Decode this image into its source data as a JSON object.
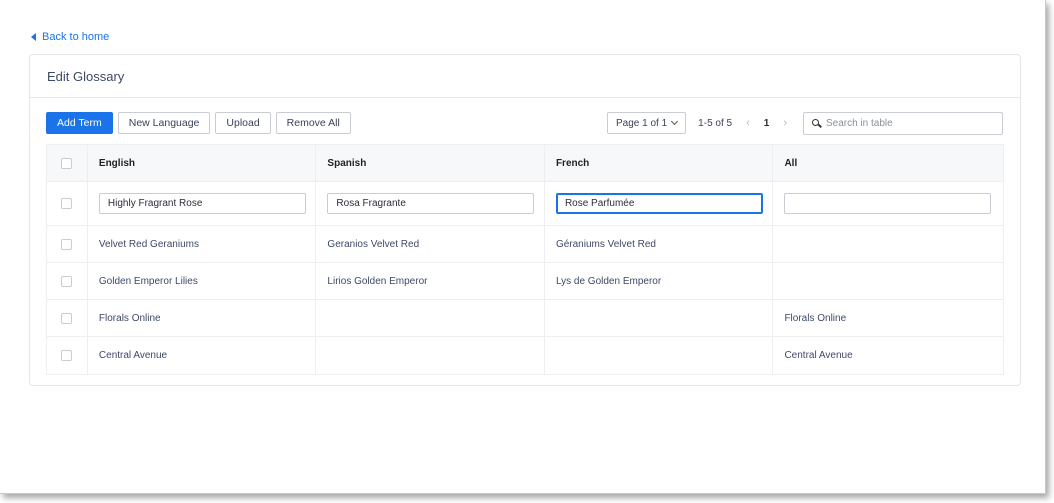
{
  "nav": {
    "back_label": "Back to home"
  },
  "card": {
    "title": "Edit Glossary"
  },
  "toolbar": {
    "add_term": "Add Term",
    "new_language": "New Language",
    "upload": "Upload",
    "remove_all": "Remove All",
    "page_select": "Page 1 of 1",
    "range": "1-5 of 5",
    "prev": "‹",
    "page": "1",
    "next": "›",
    "search_placeholder": "Search in table"
  },
  "table": {
    "columns": [
      "English",
      "Spanish",
      "French",
      "All"
    ],
    "edit_row": [
      "Highly Fragrant Rose",
      "Rosa Fragrante",
      "Rose Parfumée",
      ""
    ],
    "rows": [
      [
        "Velvet Red Geraniums",
        "Geranios Velvet Red",
        "Géraniums Velvet Red",
        ""
      ],
      [
        "Golden Emperor Lilies",
        "Lirios Golden Emperor",
        "Lys de Golden Emperor",
        ""
      ],
      [
        "Florals Online",
        "",
        "",
        "Florals Online"
      ],
      [
        "Central Avenue",
        "",
        "",
        "Central Avenue"
      ]
    ]
  },
  "colors": {
    "accent": "#1a73e8",
    "border": "#c9ccd3",
    "text": "#3d4a66"
  }
}
